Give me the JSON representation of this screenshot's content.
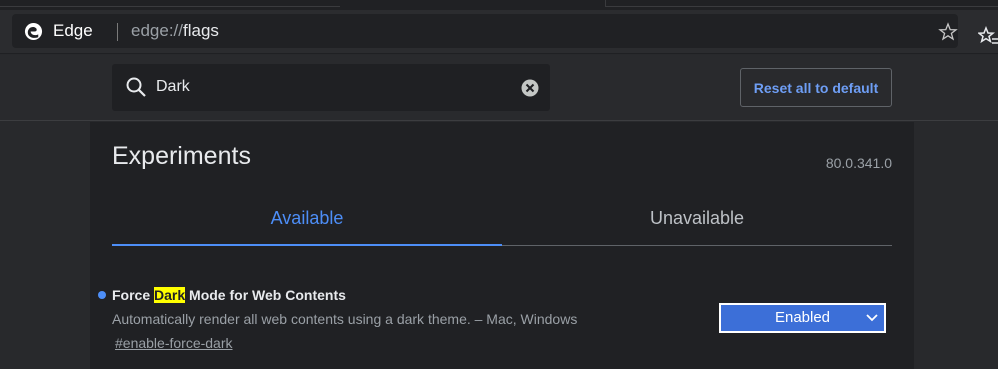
{
  "browser": {
    "site_name": "Edge",
    "url_prefix": "edge://",
    "url_path": "flags"
  },
  "search": {
    "value": "Dark",
    "reset_label": "Reset all to default"
  },
  "page": {
    "title": "Experiments",
    "version": "80.0.341.0",
    "tabs": [
      {
        "label": "Available",
        "active": true
      },
      {
        "label": "Unavailable",
        "active": false
      }
    ]
  },
  "experiments": [
    {
      "title_before": "Force ",
      "title_highlight": "Dark",
      "title_after": " Mode for Web Contents",
      "description": "Automatically render all web contents using a dark theme. – Mac, Windows",
      "link": "#enable-force-dark",
      "selected_option": "Enabled"
    }
  ],
  "colors": {
    "accent": "#4d8ef7",
    "highlight": "#ffff00",
    "select_bg": "#3c6fd8"
  },
  "icons": [
    "edge-logo-icon",
    "star-icon",
    "favorites-icon",
    "search-icon",
    "clear-icon",
    "chevron-down-icon"
  ]
}
